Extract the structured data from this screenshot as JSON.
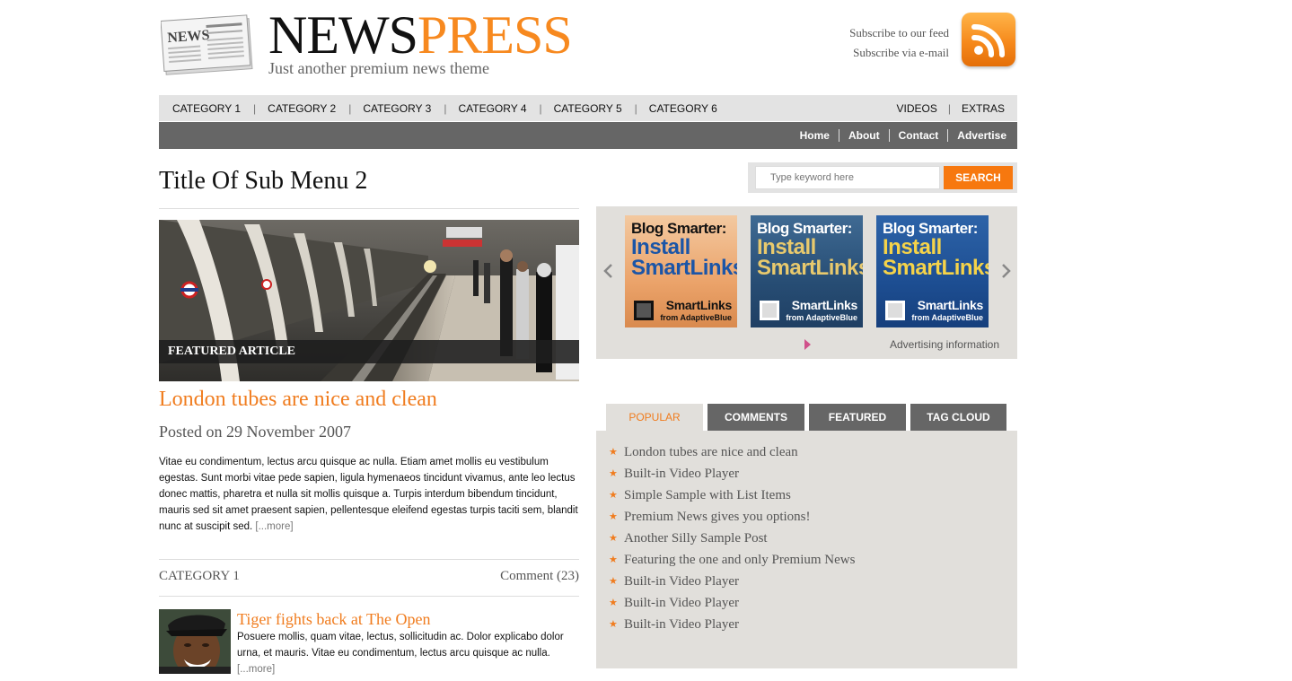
{
  "brand": {
    "name_part1": "NEWS",
    "name_part2": "PRESS",
    "tagline": "Just another premium news theme",
    "accent_color": "#f07c1e",
    "logo_icon": "newspaper-icon"
  },
  "subscribe": {
    "feed": "Subscribe to our feed",
    "email": "Subscribe via e-mail",
    "icon": "rss-icon"
  },
  "nav_primary": {
    "categories": [
      "CATEGORY 1",
      "CATEGORY 2",
      "CATEGORY 3",
      "CATEGORY 4",
      "CATEGORY 5",
      "CATEGORY 6"
    ],
    "right": [
      "VIDEOS",
      "EXTRAS"
    ]
  },
  "nav_secondary": [
    "Home",
    "About",
    "Contact",
    "Advertise"
  ],
  "page_title": "Title Of Sub Menu 2",
  "featured": {
    "label": "FEATURED ARTICLE",
    "title": "London tubes are nice and clean",
    "date": "Posted on 29 November 2007",
    "body": "Vitae eu condimentum, lectus arcu quisque ac nulla. Etiam amet mollis eu vestibulum egestas. Sunt morbi vitae pede sapien, ligula hymenaeos tincidunt vivamus, ante leo lectus donec mattis, pharetra et nulla sit mollis quisque a. Turpis interdum bibendum tincidunt, mauris sed sit amet praesent sapien, pellentesque eleifend egestas turpis taciti sem, blandit nunc at suscipit sed.",
    "more": "[...more]",
    "category": "CATEGORY 1",
    "comments": "Comment (23)"
  },
  "story": {
    "title": "Tiger fights back at The Open",
    "body": "Posuere mollis, quam vitae, lectus, sollicitudin ac. Dolor explicabo dolor urna, et mauris. Vitae eu condimentum, lectus arcu quisque ac nulla.",
    "more": "[...more]"
  },
  "search": {
    "placeholder": "Type keyword here",
    "button": "SEARCH"
  },
  "ads": {
    "items": [
      {
        "line1": "Blog Smarter:",
        "line2": "Install",
        "line3": "SmartLinks",
        "brand": "SmartLinks",
        "from": "from AdaptiveBlue"
      },
      {
        "line1": "Blog Smarter:",
        "line2": "Install",
        "line3": "SmartLinks",
        "brand": "SmartLinks",
        "from": "from AdaptiveBlue"
      },
      {
        "line1": "Blog Smarter:",
        "line2": "Install",
        "line3": "SmartLinks",
        "brand": "SmartLinks",
        "from": "from AdaptiveBlue"
      }
    ],
    "prev_icon": "chevron-left-icon",
    "next_icon": "chevron-right-icon",
    "info": "Advertising information"
  },
  "tabs": [
    "POPULAR",
    "COMMENTS",
    "FEATURED",
    "TAG CLOUD"
  ],
  "popular": [
    "London tubes are nice and clean",
    "Built-in Video Player",
    "Simple Sample with List Items",
    "Premium News gives you options!",
    "Another Silly Sample Post",
    "Featuring the one and only Premium News",
    "Built-in Video Player",
    "Built-in Video Player",
    "Built-in Video Player"
  ]
}
